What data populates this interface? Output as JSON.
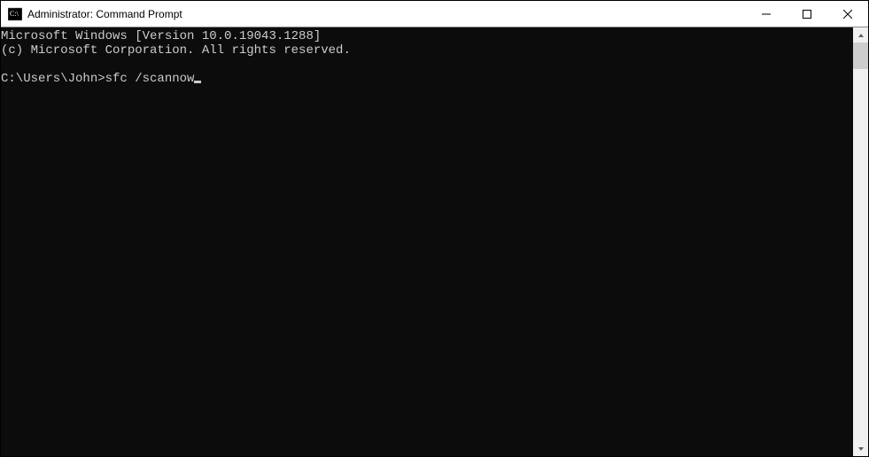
{
  "window": {
    "title": "Administrator: Command Prompt"
  },
  "console": {
    "line1": "Microsoft Windows [Version 10.0.19043.1288]",
    "line2": "(c) Microsoft Corporation. All rights reserved.",
    "blank": "",
    "prompt": "C:\\Users\\John>",
    "command": "sfc /scannow"
  }
}
